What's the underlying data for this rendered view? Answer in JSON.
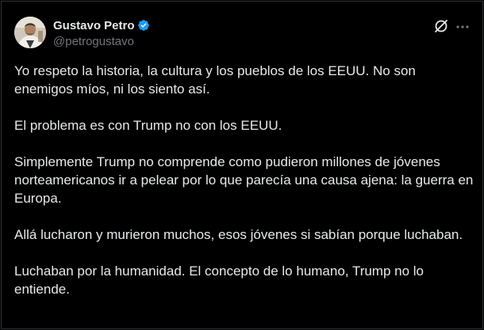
{
  "author": {
    "display_name": "Gustavo Petro",
    "handle": "@petrogustavo",
    "verified": true,
    "badge_color": "#1d9bf0",
    "avatar_icon": "avatar-photo"
  },
  "header_actions": {
    "grok_icon": "grok-icon",
    "more_icon": "more-icon"
  },
  "tweet": {
    "paragraphs": [
      "Yo respeto la historia, la cultura y los pueblos de los EEUU. No son enemigos míos, ni los siento así.",
      "El problema es con Trump no con los EEUU.",
      "Simplemente Trump no comprende como pudieron millones de jóvenes norteamericanos ir a pelear por lo que parecía una causa ajena: la guerra en Europa.",
      "Allá lucharon y murieron muchos, esos jóvenes si sabían porque luchaban.",
      "Luchaban por la humanidad. El concepto de lo humano, Trump no lo entiende."
    ]
  },
  "colors": {
    "background": "#000000",
    "text": "#e7e9ea",
    "secondary_text": "#71767b",
    "border": "#2f3336"
  }
}
